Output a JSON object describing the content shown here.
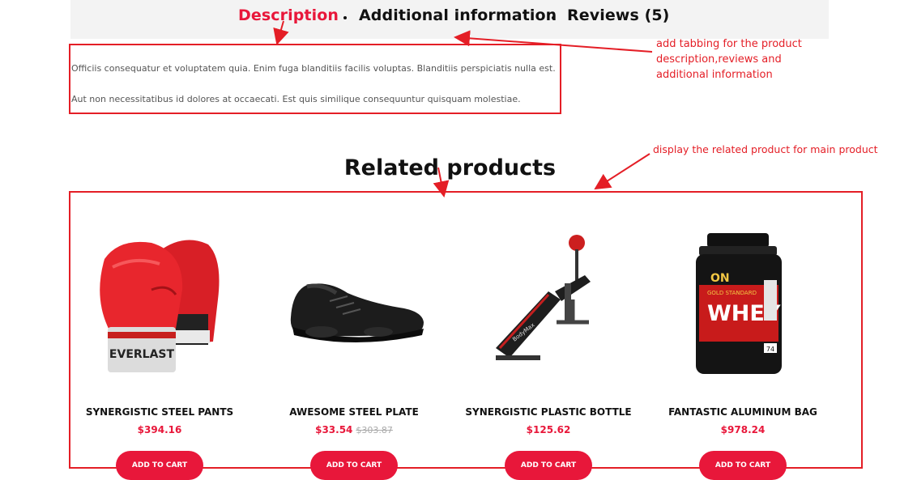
{
  "tabs": {
    "description": "Description",
    "additional": "Additional information",
    "reviews": "Reviews (5)"
  },
  "description": {
    "p1": "Officiis consequatur et voluptatem quia. Enim fuga blanditiis facilis voluptas. Blanditiis perspiciatis nulla est.",
    "p2": "Aut non necessitatibus id dolores at occaecati. Est quis similique consequuntur quisquam molestiae."
  },
  "annotations": {
    "tabbing_line1": "add tabbing for the product",
    "tabbing_line2": "description,reviews and",
    "tabbing_line3": "additional information",
    "related": "display the related product for main product"
  },
  "related": {
    "heading": "Related products",
    "products": [
      {
        "name": "SYNERGISTIC STEEL PANTS",
        "price": "$394.16",
        "old_price": "",
        "button": "ADD TO CART",
        "image": "boxing-gloves-image"
      },
      {
        "name": "AWESOME STEEL PLATE",
        "price": "$33.54",
        "old_price": "$303.87",
        "button": "ADD TO CART",
        "image": "sneaker-image"
      },
      {
        "name": "SYNERGISTIC PLASTIC BOTTLE",
        "price": "$125.62",
        "old_price": "",
        "button": "ADD TO CART",
        "image": "workout-bench-image"
      },
      {
        "name": "FANTASTIC ALUMINUM BAG",
        "price": "$978.24",
        "old_price": "",
        "button": "ADD TO CART",
        "image": "whey-protein-image"
      }
    ]
  },
  "colors": {
    "accent": "#e8173a",
    "annotation": "#e41e26",
    "tabbar_bg": "#f3f3f3"
  }
}
